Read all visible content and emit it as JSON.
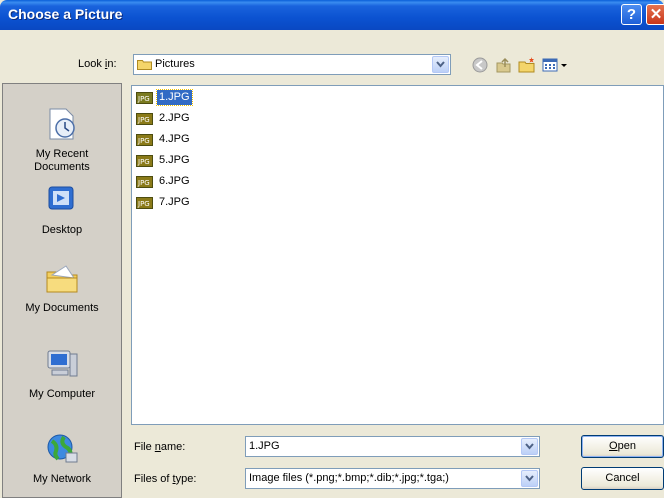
{
  "window": {
    "title": "Choose a Picture"
  },
  "toolbar": {
    "look_in_label_pre": "Look ",
    "look_in_label_ul": "i",
    "look_in_label_post": "n:",
    "look_in_value": "Pictures"
  },
  "places": [
    {
      "label_line1": "My Recent",
      "label_line2": "Documents",
      "icon": "my-recent-documents-icon"
    },
    {
      "label_line1": "Desktop",
      "label_line2": "",
      "icon": "desktop-icon"
    },
    {
      "label_line1": "My Documents",
      "label_line2": "",
      "icon": "my-documents-icon"
    },
    {
      "label_line1": "My Computer",
      "label_line2": "",
      "icon": "my-computer-icon"
    },
    {
      "label_line1": "My Network",
      "label_line2": "",
      "icon": "my-network-icon"
    }
  ],
  "files": [
    {
      "name": "1.JPG",
      "selected": true
    },
    {
      "name": "2.JPG"
    },
    {
      "name": "4.JPG"
    },
    {
      "name": "5.JPG"
    },
    {
      "name": "6.JPG"
    },
    {
      "name": "7.JPG"
    }
  ],
  "file_name": {
    "label_pre": "File ",
    "label_ul": "n",
    "label_post": "ame:",
    "value": "1.JPG"
  },
  "file_type": {
    "label_pre": "Files of ",
    "label_ul": "t",
    "label_post": "ype:",
    "value": "Image files (*.png;*.bmp;*.dib;*.jpg;*.tga;)"
  },
  "buttons": {
    "open_ul": "O",
    "open_rest": "pen",
    "cancel": "Cancel"
  },
  "colors": {
    "selection": "#316ac5",
    "titlebar": "#0a48c2",
    "dialog": "#ece9d8"
  }
}
